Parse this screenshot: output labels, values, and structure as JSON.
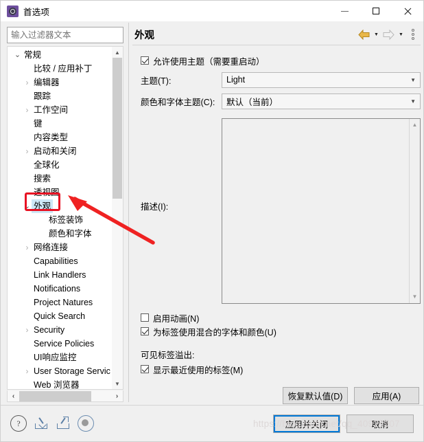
{
  "window": {
    "title": "首选项",
    "icon": "preferences-gear-icon",
    "controls": {
      "minimize": "minimize-icon",
      "maximize": "maximize-icon",
      "close": "close-icon"
    }
  },
  "filter": {
    "placeholder": "输入过滤器文本",
    "value": ""
  },
  "tree": {
    "items": [
      {
        "label": "常规",
        "indent": 0,
        "expander": "down",
        "selected": false
      },
      {
        "label": "比较 / 应用补丁",
        "indent": 1,
        "expander": "none",
        "selected": false
      },
      {
        "label": "编辑器",
        "indent": 1,
        "expander": "right",
        "selected": false
      },
      {
        "label": "跟踪",
        "indent": 1,
        "expander": "none",
        "selected": false
      },
      {
        "label": "工作空间",
        "indent": 1,
        "expander": "right",
        "selected": false
      },
      {
        "label": "键",
        "indent": 1,
        "expander": "none",
        "selected": false
      },
      {
        "label": "内容类型",
        "indent": 1,
        "expander": "none",
        "selected": false
      },
      {
        "label": "启动和关闭",
        "indent": 1,
        "expander": "right",
        "selected": false
      },
      {
        "label": "全球化",
        "indent": 1,
        "expander": "none",
        "selected": false
      },
      {
        "label": "搜索",
        "indent": 1,
        "expander": "none",
        "selected": false
      },
      {
        "label": "透视图",
        "indent": 1,
        "expander": "none",
        "selected": false
      },
      {
        "label": "外观",
        "indent": 1,
        "expander": "down",
        "selected": true
      },
      {
        "label": "标签装饰",
        "indent": 2,
        "expander": "none",
        "selected": false
      },
      {
        "label": "颜色和字体",
        "indent": 2,
        "expander": "none",
        "selected": false
      },
      {
        "label": "网络连接",
        "indent": 1,
        "expander": "right",
        "selected": false
      },
      {
        "label": "Capabilities",
        "indent": 1,
        "expander": "none",
        "selected": false
      },
      {
        "label": "Link Handlers",
        "indent": 1,
        "expander": "none",
        "selected": false
      },
      {
        "label": "Notifications",
        "indent": 1,
        "expander": "none",
        "selected": false
      },
      {
        "label": "Project Natures",
        "indent": 1,
        "expander": "none",
        "selected": false
      },
      {
        "label": "Quick Search",
        "indent": 1,
        "expander": "none",
        "selected": false
      },
      {
        "label": "Security",
        "indent": 1,
        "expander": "right",
        "selected": false
      },
      {
        "label": "Service Policies",
        "indent": 1,
        "expander": "none",
        "selected": false
      },
      {
        "label": "UI响应监控",
        "indent": 1,
        "expander": "none",
        "selected": false
      },
      {
        "label": "User Storage Servic",
        "indent": 1,
        "expander": "right",
        "selected": false
      },
      {
        "label": "Web 浏览器",
        "indent": 1,
        "expander": "none",
        "selected": false
      }
    ]
  },
  "pane": {
    "title": "外观",
    "nav": {
      "back": "back-arrow-icon",
      "back_menu": "chevron-down-icon",
      "forward": "forward-arrow-icon",
      "forward_menu": "chevron-down-icon",
      "more": "view-menu-icon"
    },
    "enable_theming": {
      "label": "允许使用主题（需要重启动）",
      "checked": true
    },
    "theme": {
      "label": "主题(T):",
      "value": "Light"
    },
    "color_font_theme": {
      "label": "颜色和字体主题(C):",
      "value": "默认（当前）"
    },
    "description": {
      "label": "描述(I):",
      "value": ""
    },
    "enable_animations": {
      "label": "启用动画(N)",
      "checked": false
    },
    "mixed_fonts": {
      "label": "为标签使用混合的字体和颜色(U)",
      "checked": true
    },
    "overflow_section": {
      "label": "可见标签溢出:"
    },
    "show_recent": {
      "label": "显示最近使用的标签(M)",
      "checked": true
    },
    "restore_defaults": "恢复默认值(D)",
    "apply": "应用(A)"
  },
  "footer": {
    "icons": [
      {
        "name": "help-icon",
        "glyph": "?"
      },
      {
        "name": "import-icon"
      },
      {
        "name": "export-icon"
      },
      {
        "name": "status-circle-icon"
      }
    ],
    "apply_and_close": "应用并关闭",
    "cancel": "取消"
  },
  "watermark": "https://blog.csdn.net/qq_40926907",
  "colors": {
    "selection": "#cde8f6",
    "annotation": "#e81123",
    "focus": "#0078d7",
    "back_arrow": "#e3a520"
  }
}
